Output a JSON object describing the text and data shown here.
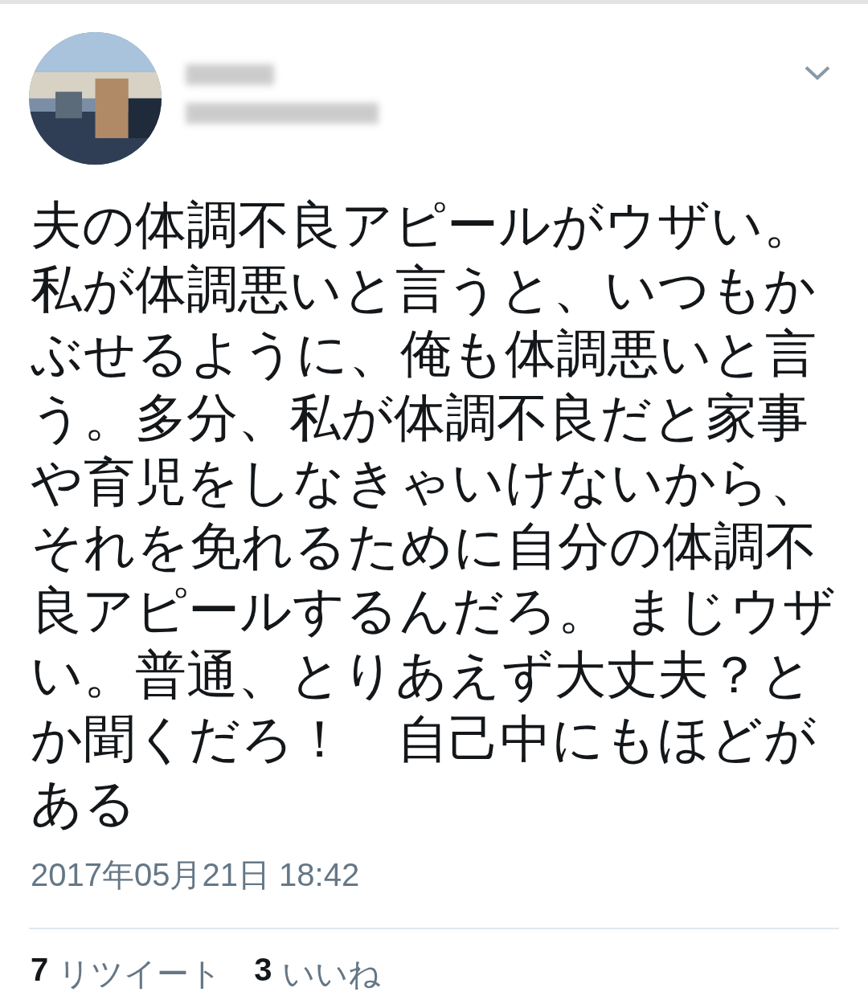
{
  "tweet": {
    "text": "夫の体調不良アピールがウザい。私が体調悪いと言うと、いつもかぶせるように、俺も体調悪いと言う。多分、私が体調不良だと家事や育児をしなきゃいけないから、それを免れるために自分の体調不良アピールするんだろ。 まじウザい。普通、とりあえず大丈夫？とか聞くだろ！　自己中にもほどがある",
    "timestamp": "2017年05月21日 18:42",
    "stats": [
      {
        "count": "7",
        "label": "リツイート"
      },
      {
        "count": "3",
        "label": "いいね"
      }
    ]
  }
}
